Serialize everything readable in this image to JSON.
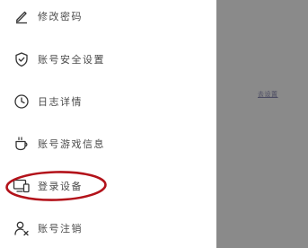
{
  "menu": {
    "items": [
      {
        "icon": "pencil-icon",
        "label": "修改密码"
      },
      {
        "icon": "shield-check-icon",
        "label": "账号安全设置"
      },
      {
        "icon": "clock-icon",
        "label": "日志详情"
      },
      {
        "icon": "coffee-cup-icon",
        "label": "账号游戏信息"
      },
      {
        "icon": "devices-icon",
        "label": "登录设备"
      },
      {
        "icon": "user-remove-icon",
        "label": "账号注销"
      }
    ],
    "highlighted_item": "登录设备",
    "highlight_color": "#b3121a"
  },
  "overlay": {
    "link_text": "去设置",
    "background_color": "#8a8a8a"
  }
}
